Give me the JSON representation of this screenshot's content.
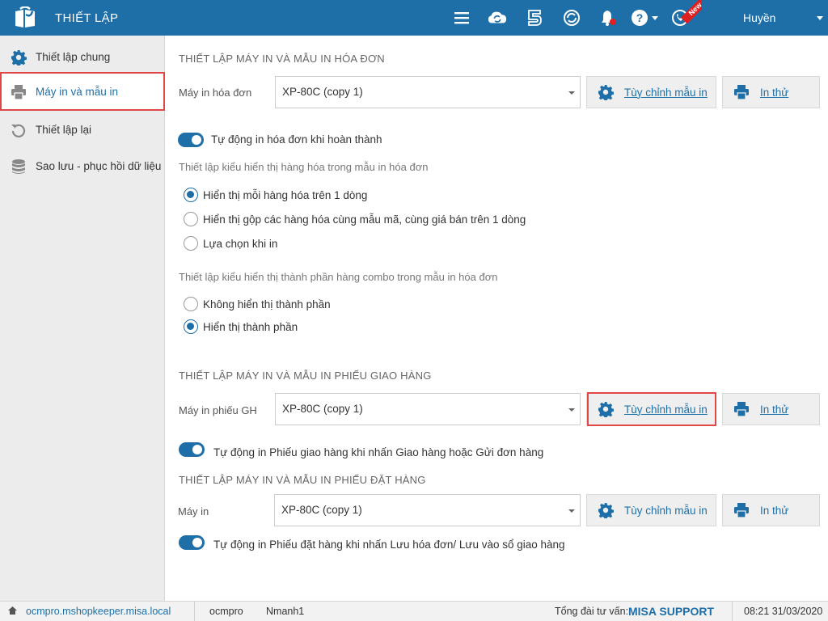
{
  "app": {
    "title": "THIẾT LẬP"
  },
  "header": {
    "icons": [
      "menu-icon",
      "cloud-sync-icon",
      "five-icon",
      "refresh-app-icon",
      "bell-icon",
      "help-icon",
      "whatsapp-icon"
    ],
    "new_badge": "New",
    "user": "Huyền"
  },
  "sidebar": {
    "items": [
      {
        "label": "Thiết lập chung",
        "icon": "gear-icon"
      },
      {
        "label": "Máy in và mẫu in",
        "icon": "printer-icon",
        "active": true
      },
      {
        "label": "Thiết lập lại",
        "icon": "undo-icon"
      },
      {
        "label": "Sao lưu - phục hồi dữ liệu",
        "icon": "database-icon"
      }
    ]
  },
  "invoice": {
    "title": "THIẾT LẬP MÁY IN VÀ MẪU IN HÓA ĐƠN",
    "printer_label": "Máy in hóa đơn",
    "printer_value": "XP-80C (copy 1)",
    "custom_label": "Tùy chỉnh mẫu in",
    "test_label": "In thử",
    "auto_print": "Tự động in hóa đơn khi hoàn thành",
    "display_heading": "Thiết lập kiểu hiển thị hàng hóa trong mẫu in hóa đơn",
    "display_options": [
      {
        "label": "Hiển thị mỗi hàng hóa trên 1 dòng",
        "selected": true
      },
      {
        "label": "Hiển thị gộp các hàng hóa cùng mẫu mã, cùng giá bán trên 1 dòng",
        "selected": false
      },
      {
        "label": "Lựa chọn khi in",
        "selected": false
      }
    ],
    "combo_heading": "Thiết lập kiểu hiển thị thành phần hàng combo trong mẫu in hóa đơn",
    "combo_options": [
      {
        "label": "Không hiển thị thành phần",
        "selected": false
      },
      {
        "label": "Hiển thị thành phần",
        "selected": true
      }
    ]
  },
  "delivery": {
    "title": "THIẾT LẬP MÁY IN VÀ MẪU IN PHIẾU GIAO HÀNG",
    "printer_label": "Máy in phiếu GH",
    "printer_value": "XP-80C (copy 1)",
    "custom_label": "Tùy chỉnh mẫu in",
    "test_label": "In thử",
    "auto_print": "Tự động in Phiếu giao hàng khi nhấn Giao hàng hoặc Gửi đơn hàng"
  },
  "order": {
    "title": "THIẾT LẬP MÁY IN VÀ MẪU IN PHIẾU ĐẶT HÀNG",
    "printer_label": "Máy in",
    "printer_value": "XP-80C (copy 1)",
    "custom_label": "Tùy chỉnh mẫu in",
    "test_label": "In thử",
    "auto_print": "Tự động in Phiếu đặt hàng khi nhấn Lưu hóa đơn/ Lưu vào sổ giao hàng"
  },
  "status": {
    "host": "ocmpro.mshopkeeper.misa.local",
    "shop": "ocmpro",
    "user": "Nmanh1",
    "hotline_label": "Tổng đài tư vấn:",
    "hotline_brand": "MISA SUPPORT",
    "datetime": "08:21 31/03/2020"
  },
  "colors": {
    "primary": "#1e6fa7",
    "highlight": "#e04848",
    "sidebar_bg": "#ececec"
  }
}
